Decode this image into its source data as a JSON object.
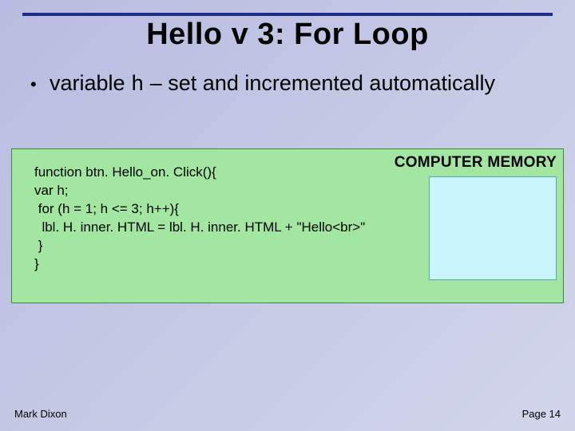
{
  "title": "Hello v 3: For Loop",
  "bullet": {
    "prefix": "variable ",
    "varname": "h",
    "rest": " – set and incremented automatically"
  },
  "code": {
    "line1": "function btn. Hello_on. Click(){",
    "line2": "var h;",
    "line3": " for (h = 1; h <= 3; h++){",
    "line4": "  lbl. H. inner. HTML = lbl. H. inner. HTML + \"Hello<br>\"",
    "line5": " }",
    "line6": "}"
  },
  "memory_label": "COMPUTER MEMORY",
  "footer": {
    "author": "Mark Dixon",
    "page": "Page 14"
  }
}
